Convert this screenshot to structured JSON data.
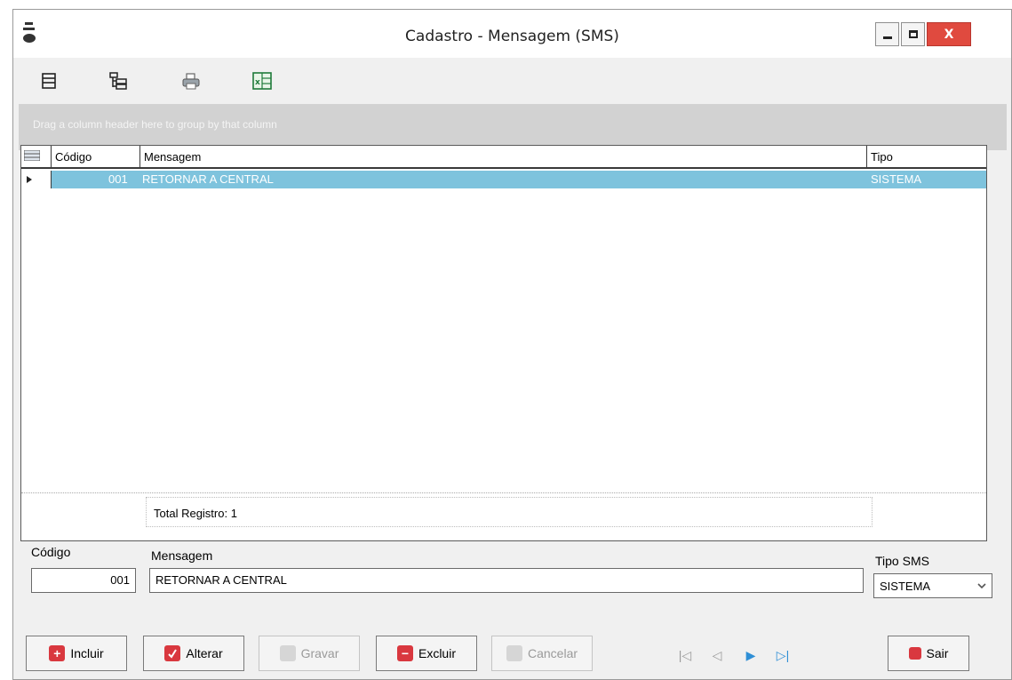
{
  "window": {
    "title": "Cadastro - Mensagem (SMS)",
    "close_label": "X"
  },
  "toolbar": {
    "icons": [
      "grid-layout-icon",
      "tree-view-icon",
      "printer-icon",
      "excel-export-icon"
    ]
  },
  "grid": {
    "group_hint": "Drag a column header here to group by that column",
    "columns": [
      "Código",
      "Mensagem",
      "Tipo"
    ],
    "rows": [
      {
        "codigo": "001",
        "mensagem": "RETORNAR A CENTRAL",
        "tipo": "SISTEMA"
      }
    ],
    "footer": "Total Registro: 1"
  },
  "form": {
    "codigo_label": "Código",
    "codigo_value": "001",
    "mensagem_label": "Mensagem",
    "mensagem_value": "RETORNAR A CENTRAL",
    "tipo_label": "Tipo SMS",
    "tipo_value": "SISTEMA"
  },
  "buttons": {
    "incluir": "Incluir",
    "alterar": "Alterar",
    "gravar": "Gravar",
    "excluir": "Excluir",
    "cancelar": "Cancelar",
    "sair": "Sair"
  },
  "colors": {
    "selection": "#7ec3dd",
    "close": "#e04a3f",
    "accent_red": "#d9383f"
  }
}
